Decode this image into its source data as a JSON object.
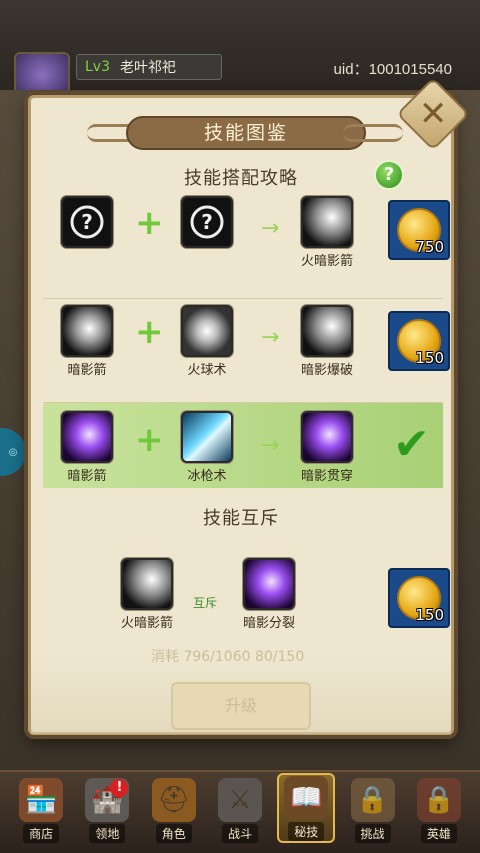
{
  "player": {
    "level": "Lv3",
    "name": "老叶祁祀",
    "uid": "uid：1001015540"
  },
  "modal": {
    "title": "技能图鉴",
    "section_combo": "技能搭配攻略",
    "section_exclusive": "技能互斥",
    "help": "?",
    "close": "✕",
    "combos": [
      {
        "a_label": "",
        "b_label": "",
        "result_label": "火暗影箭",
        "price": "750",
        "done": false
      },
      {
        "a_label": "暗影箭",
        "b_label": "火球术",
        "result_label": "暗影爆破",
        "price": "150",
        "done": false
      },
      {
        "a_label": "暗影箭",
        "b_label": "冰枪术",
        "result_label": "暗影贯穿",
        "price": "",
        "done": true
      }
    ],
    "exclusive": {
      "a_label": "火暗影箭",
      "b_label": "暗影分裂",
      "middle": "互斥",
      "price": "150"
    },
    "cost_text": "消耗 796/1060  80/150",
    "upgrade_label": "升级"
  },
  "nav": [
    {
      "label": "商店",
      "icon": "shop-icon",
      "badge": ""
    },
    {
      "label": "领地",
      "icon": "territory-icon",
      "badge": "!"
    },
    {
      "label": "角色",
      "icon": "hero-icon",
      "badge": ""
    },
    {
      "label": "战斗",
      "icon": "battle-icon",
      "badge": ""
    },
    {
      "label": "秘技",
      "icon": "skill-book-icon",
      "badge": ""
    },
    {
      "label": "挑战",
      "icon": "lock-icon",
      "badge": ""
    },
    {
      "label": "英雄",
      "icon": "lock-icon",
      "badge": ""
    }
  ],
  "colors": {
    "panel": "#eee6cf",
    "banner": "#8a6b45",
    "accent_green": "#6fc93a",
    "price_blue": "#1a4a8a",
    "active_nav": "#e6b94a"
  }
}
